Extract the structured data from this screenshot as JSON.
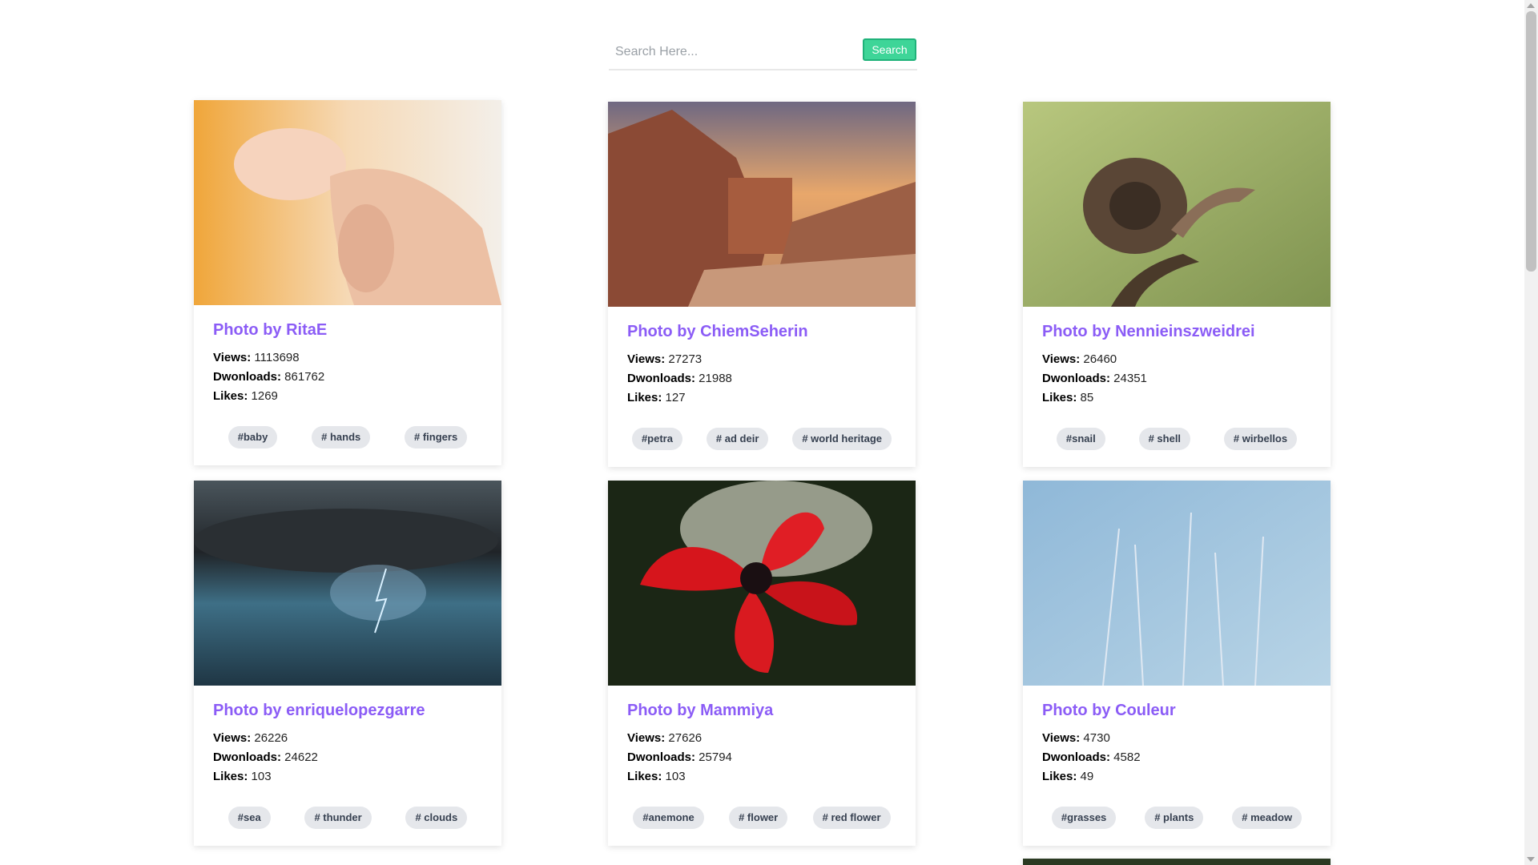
{
  "search": {
    "placeholder": "Search Here...",
    "button_label": "Search"
  },
  "label_views": "Views:",
  "label_downloads": "Dwonloads:",
  "label_likes": "Likes:",
  "cards": [
    {
      "title": "Photo by RitaE",
      "views": "1113698",
      "downloads": "861762",
      "likes": "1269",
      "tags": [
        "#baby",
        "# hands",
        "# fingers"
      ],
      "image": "baby hand holding adult finger"
    },
    {
      "title": "Photo by ChiemSeherin",
      "views": "27273",
      "downloads": "21988",
      "likes": "127",
      "tags": [
        "#petra",
        "# ad deir",
        "# world heritage"
      ],
      "image": "petra monastery rock landscape"
    },
    {
      "title": "Photo by Nennieinszweidrei",
      "views": "26460",
      "downloads": "24351",
      "likes": "85",
      "tags": [
        "#snail",
        "# shell",
        "# wirbellos"
      ],
      "image": "snail on branch"
    },
    {
      "title": "Photo by enriquelopezgarre",
      "views": "26226",
      "downloads": "24622",
      "likes": "103",
      "tags": [
        "#sea",
        "# thunder",
        "# clouds"
      ],
      "image": "storm clouds lightning over sea"
    },
    {
      "title": "Photo by Mammiya",
      "views": "27626",
      "downloads": "25794",
      "likes": "103",
      "tags": [
        "#anemone",
        "# flower",
        "# red flower"
      ],
      "image": "red anemone flower"
    },
    {
      "title": "Photo by Couleur",
      "views": "4730",
      "downloads": "4582",
      "likes": "49",
      "tags": [
        "#grasses",
        "# plants",
        "# meadow"
      ],
      "image": "blue grasses meadow"
    }
  ],
  "colors": {
    "accent_title": "#8b5cf6",
    "search_button": "#3ed598",
    "tag_bg": "#e5e7eb"
  }
}
